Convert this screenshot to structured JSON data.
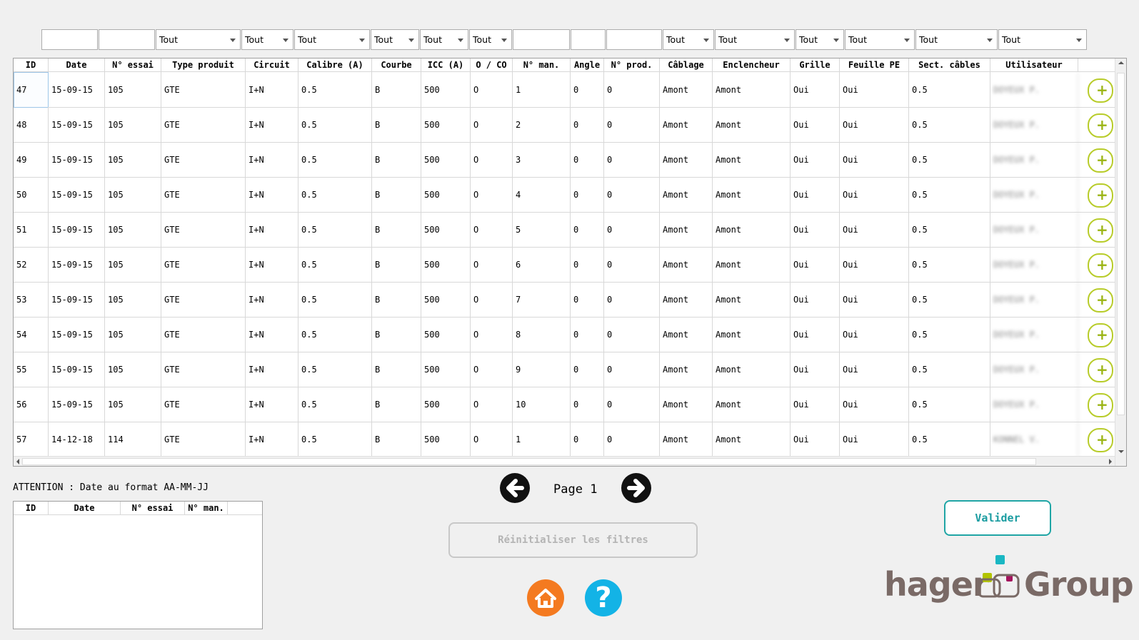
{
  "filters": {
    "select_default": "Tout"
  },
  "table": {
    "columns": [
      "ID",
      "Date",
      "N° essai",
      "Type produit",
      "Circuit",
      "Calibre (A)",
      "Courbe",
      "ICC (A)",
      "O / CO",
      "N° man.",
      "Angle",
      "N° prod.",
      "Câblage",
      "Enclencheur",
      "Grille",
      "Feuille PE",
      "Sect. câbles",
      "Utilisateur"
    ],
    "rows": [
      {
        "id": "47",
        "date": "15-09-15",
        "essai": "105",
        "type": "GTE",
        "circuit": "I+N",
        "calibre": "0.5",
        "courbe": "B",
        "icc": "500",
        "oco": "O",
        "man": "1",
        "angle": "0",
        "prod": "0",
        "cablage": "Amont",
        "enclencheur": "Amont",
        "grille": "Oui",
        "feuille": "Oui",
        "sect": "0.5",
        "user": "DOYEUX P."
      },
      {
        "id": "48",
        "date": "15-09-15",
        "essai": "105",
        "type": "GTE",
        "circuit": "I+N",
        "calibre": "0.5",
        "courbe": "B",
        "icc": "500",
        "oco": "O",
        "man": "2",
        "angle": "0",
        "prod": "0",
        "cablage": "Amont",
        "enclencheur": "Amont",
        "grille": "Oui",
        "feuille": "Oui",
        "sect": "0.5",
        "user": "DOYEUX P."
      },
      {
        "id": "49",
        "date": "15-09-15",
        "essai": "105",
        "type": "GTE",
        "circuit": "I+N",
        "calibre": "0.5",
        "courbe": "B",
        "icc": "500",
        "oco": "O",
        "man": "3",
        "angle": "0",
        "prod": "0",
        "cablage": "Amont",
        "enclencheur": "Amont",
        "grille": "Oui",
        "feuille": "Oui",
        "sect": "0.5",
        "user": "DOYEUX P."
      },
      {
        "id": "50",
        "date": "15-09-15",
        "essai": "105",
        "type": "GTE",
        "circuit": "I+N",
        "calibre": "0.5",
        "courbe": "B",
        "icc": "500",
        "oco": "O",
        "man": "4",
        "angle": "0",
        "prod": "0",
        "cablage": "Amont",
        "enclencheur": "Amont",
        "grille": "Oui",
        "feuille": "Oui",
        "sect": "0.5",
        "user": "DOYEUX P."
      },
      {
        "id": "51",
        "date": "15-09-15",
        "essai": "105",
        "type": "GTE",
        "circuit": "I+N",
        "calibre": "0.5",
        "courbe": "B",
        "icc": "500",
        "oco": "O",
        "man": "5",
        "angle": "0",
        "prod": "0",
        "cablage": "Amont",
        "enclencheur": "Amont",
        "grille": "Oui",
        "feuille": "Oui",
        "sect": "0.5",
        "user": "DOYEUX P."
      },
      {
        "id": "52",
        "date": "15-09-15",
        "essai": "105",
        "type": "GTE",
        "circuit": "I+N",
        "calibre": "0.5",
        "courbe": "B",
        "icc": "500",
        "oco": "O",
        "man": "6",
        "angle": "0",
        "prod": "0",
        "cablage": "Amont",
        "enclencheur": "Amont",
        "grille": "Oui",
        "feuille": "Oui",
        "sect": "0.5",
        "user": "DOYEUX P."
      },
      {
        "id": "53",
        "date": "15-09-15",
        "essai": "105",
        "type": "GTE",
        "circuit": "I+N",
        "calibre": "0.5",
        "courbe": "B",
        "icc": "500",
        "oco": "O",
        "man": "7",
        "angle": "0",
        "prod": "0",
        "cablage": "Amont",
        "enclencheur": "Amont",
        "grille": "Oui",
        "feuille": "Oui",
        "sect": "0.5",
        "user": "DOYEUX P."
      },
      {
        "id": "54",
        "date": "15-09-15",
        "essai": "105",
        "type": "GTE",
        "circuit": "I+N",
        "calibre": "0.5",
        "courbe": "B",
        "icc": "500",
        "oco": "O",
        "man": "8",
        "angle": "0",
        "prod": "0",
        "cablage": "Amont",
        "enclencheur": "Amont",
        "grille": "Oui",
        "feuille": "Oui",
        "sect": "0.5",
        "user": "DOYEUX P."
      },
      {
        "id": "55",
        "date": "15-09-15",
        "essai": "105",
        "type": "GTE",
        "circuit": "I+N",
        "calibre": "0.5",
        "courbe": "B",
        "icc": "500",
        "oco": "O",
        "man": "9",
        "angle": "0",
        "prod": "0",
        "cablage": "Amont",
        "enclencheur": "Amont",
        "grille": "Oui",
        "feuille": "Oui",
        "sect": "0.5",
        "user": "DOYEUX P."
      },
      {
        "id": "56",
        "date": "15-09-15",
        "essai": "105",
        "type": "GTE",
        "circuit": "I+N",
        "calibre": "0.5",
        "courbe": "B",
        "icc": "500",
        "oco": "O",
        "man": "10",
        "angle": "0",
        "prod": "0",
        "cablage": "Amont",
        "enclencheur": "Amont",
        "grille": "Oui",
        "feuille": "Oui",
        "sect": "0.5",
        "user": "DOYEUX P."
      },
      {
        "id": "57",
        "date": "14-12-18",
        "essai": "114",
        "type": "GTE",
        "circuit": "I+N",
        "calibre": "0.5",
        "courbe": "B",
        "icc": "500",
        "oco": "O",
        "man": "1",
        "angle": "0",
        "prod": "0",
        "cablage": "Amont",
        "enclencheur": "Amont",
        "grille": "Oui",
        "feuille": "Oui",
        "sect": "0.5",
        "user": "KONNEL V."
      }
    ],
    "row_action_icon": "plus-icon"
  },
  "warning": {
    "text": "ATTENTION : Date au format AA-MM-JJ"
  },
  "selection_table": {
    "columns": [
      "ID",
      "Date",
      "N° essai",
      "N° man."
    ]
  },
  "pagination": {
    "label": "Page",
    "page": "1",
    "prev_icon": "arrow-left-icon",
    "next_icon": "arrow-right-icon"
  },
  "buttons": {
    "reset": "Réinitialiser les filtres",
    "validate": "Valider",
    "home_icon": "home-icon",
    "help_icon": "question-icon",
    "help_glyph": "?"
  },
  "logo": {
    "text_left": "hager",
    "text_right": "Group"
  },
  "colors": {
    "accent_teal": "#1fa5a5",
    "plus_green": "#b8cc2a",
    "home_orange": "#f47a20",
    "help_blue": "#13b3e6",
    "logo_brown": "#7a6a66",
    "logo_cyan": "#1ab7c3",
    "logo_lime": "#b2c400",
    "logo_magenta": "#a4135d"
  }
}
